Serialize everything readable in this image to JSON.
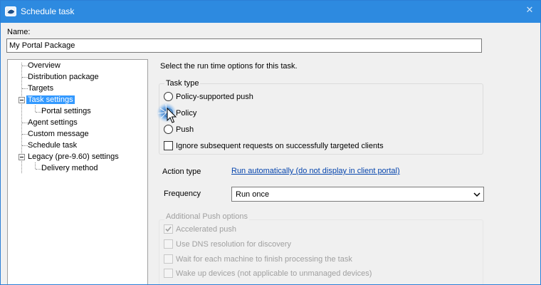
{
  "window": {
    "title": "Schedule task"
  },
  "name": {
    "label": "Name:",
    "value": "My Portal Package"
  },
  "tree": {
    "items": [
      {
        "label": "Overview"
      },
      {
        "label": "Distribution package"
      },
      {
        "label": "Targets"
      },
      {
        "label": "Task settings",
        "selected": true
      },
      {
        "label": "Portal settings"
      },
      {
        "label": "Agent settings"
      },
      {
        "label": "Custom message"
      },
      {
        "label": "Schedule task"
      },
      {
        "label": "Legacy (pre-9.60) settings"
      },
      {
        "label": "Delivery method"
      }
    ]
  },
  "intro": "Select the run time options for this task.",
  "task_type": {
    "title": "Task type",
    "options": [
      {
        "label": "Policy-supported push",
        "checked": false
      },
      {
        "label": "Policy",
        "checked": false
      },
      {
        "label": "Push",
        "checked": false
      }
    ],
    "ignore_label": "Ignore subsequent requests on successfully targeted clients"
  },
  "action_type": {
    "label": "Action type",
    "link": "Run automatically (do not display in client portal)"
  },
  "frequency": {
    "label": "Frequency",
    "selected": "Run once"
  },
  "push_options": {
    "title": "Additional Push options",
    "items": [
      {
        "label": "Accelerated push",
        "checked": true
      },
      {
        "label": "Use DNS resolution for discovery",
        "checked": false
      },
      {
        "label": "Wait for each machine to finish processing the task",
        "checked": false
      },
      {
        "label": "Wake up devices (not applicable to unmanaged devices)",
        "checked": false
      }
    ]
  },
  "colors": {
    "titlebar": "#2d8ae0",
    "selection": "#3399ff",
    "link": "#0645ad"
  },
  "icons": {
    "app": "app-icon",
    "close": "close-icon",
    "cursor": "mouse-cursor-icon"
  }
}
